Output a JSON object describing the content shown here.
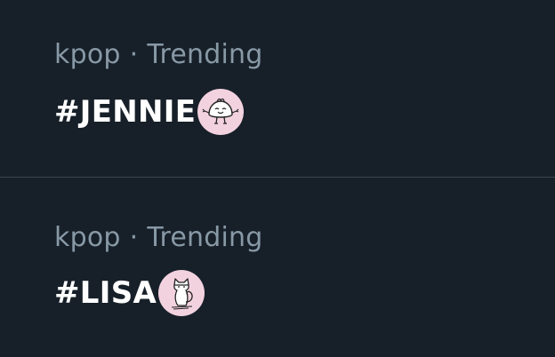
{
  "trends": [
    {
      "category": "kpop",
      "separator": "·",
      "status": "Trending",
      "hashtag": "#JENNIE",
      "emoji_icon": "dumpling-character-icon"
    },
    {
      "category": "kpop",
      "separator": "·",
      "status": "Trending",
      "hashtag": "#LISA",
      "emoji_icon": "cat-character-icon"
    }
  ],
  "colors": {
    "background": "#172029",
    "meta_text": "#8899a6",
    "title_text": "#ffffff",
    "divider": "#38444d",
    "emoji_bg": "#f3d2df"
  }
}
